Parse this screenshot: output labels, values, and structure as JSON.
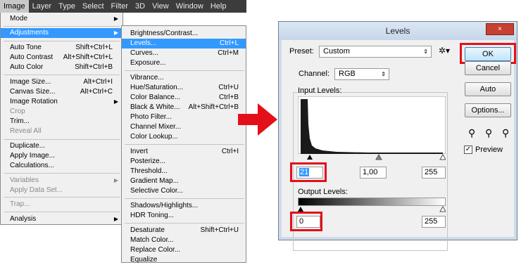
{
  "menubar": {
    "items": [
      "Image",
      "Layer",
      "Type",
      "Select",
      "Filter",
      "3D",
      "View",
      "Window",
      "Help"
    ]
  },
  "image_menu": {
    "items": [
      {
        "label": "Mode",
        "submenu": true
      },
      {
        "label": "Adjustments",
        "submenu": true,
        "selected": true
      },
      {
        "label": "Auto Tone",
        "shortcut": "Shift+Ctrl+L"
      },
      {
        "label": "Auto Contrast",
        "shortcut": "Alt+Shift+Ctrl+L"
      },
      {
        "label": "Auto Color",
        "shortcut": "Shift+Ctrl+B"
      },
      {
        "label": "Image Size...",
        "shortcut": "Alt+Ctrl+I"
      },
      {
        "label": "Canvas Size...",
        "shortcut": "Alt+Ctrl+C"
      },
      {
        "label": "Image Rotation",
        "submenu": true
      },
      {
        "label": "Crop",
        "disabled": true
      },
      {
        "label": "Trim..."
      },
      {
        "label": "Reveal All",
        "disabled": true
      },
      {
        "label": "Duplicate..."
      },
      {
        "label": "Apply Image..."
      },
      {
        "label": "Calculations..."
      },
      {
        "label": "Variables",
        "submenu": true,
        "disabled": true
      },
      {
        "label": "Apply Data Set...",
        "disabled": true
      },
      {
        "label": "Trap...",
        "disabled": true
      },
      {
        "label": "Analysis",
        "submenu": true
      }
    ]
  },
  "adjustments_menu": {
    "items": [
      {
        "label": "Brightness/Contrast..."
      },
      {
        "label": "Levels...",
        "shortcut": "Ctrl+L",
        "selected": true
      },
      {
        "label": "Curves...",
        "shortcut": "Ctrl+M"
      },
      {
        "label": "Exposure..."
      },
      {
        "label": "Vibrance..."
      },
      {
        "label": "Hue/Saturation...",
        "shortcut": "Ctrl+U"
      },
      {
        "label": "Color Balance...",
        "shortcut": "Ctrl+B"
      },
      {
        "label": "Black & White...",
        "shortcut": "Alt+Shift+Ctrl+B"
      },
      {
        "label": "Photo Filter..."
      },
      {
        "label": "Channel Mixer..."
      },
      {
        "label": "Color Lookup..."
      },
      {
        "label": "Invert",
        "shortcut": "Ctrl+I"
      },
      {
        "label": "Posterize..."
      },
      {
        "label": "Threshold..."
      },
      {
        "label": "Gradient Map..."
      },
      {
        "label": "Selective Color..."
      },
      {
        "label": "Shadows/Highlights..."
      },
      {
        "label": "HDR Toning..."
      },
      {
        "label": "Desaturate",
        "shortcut": "Shift+Ctrl+U"
      },
      {
        "label": "Match Color..."
      },
      {
        "label": "Replace Color..."
      },
      {
        "label": "Equalize"
      }
    ]
  },
  "dialog": {
    "title": "Levels",
    "close_label": "×",
    "preset_label": "Preset:",
    "preset_value": "Custom",
    "channel_label": "Channel:",
    "channel_value": "RGB",
    "input_levels_label": "Input Levels:",
    "input_black": "21",
    "input_gamma": "1,00",
    "input_white": "255",
    "output_levels_label": "Output Levels:",
    "output_black": "0",
    "output_white": "255",
    "ok_label": "OK",
    "cancel_label": "Cancel",
    "auto_label": "Auto",
    "options_label": "Options...",
    "preview_label": "Preview",
    "preview_checked": true
  },
  "colors": {
    "highlight": "#3399ff",
    "annotation_red": "#e3101a",
    "menubar_bg": "#3c3c3c"
  }
}
